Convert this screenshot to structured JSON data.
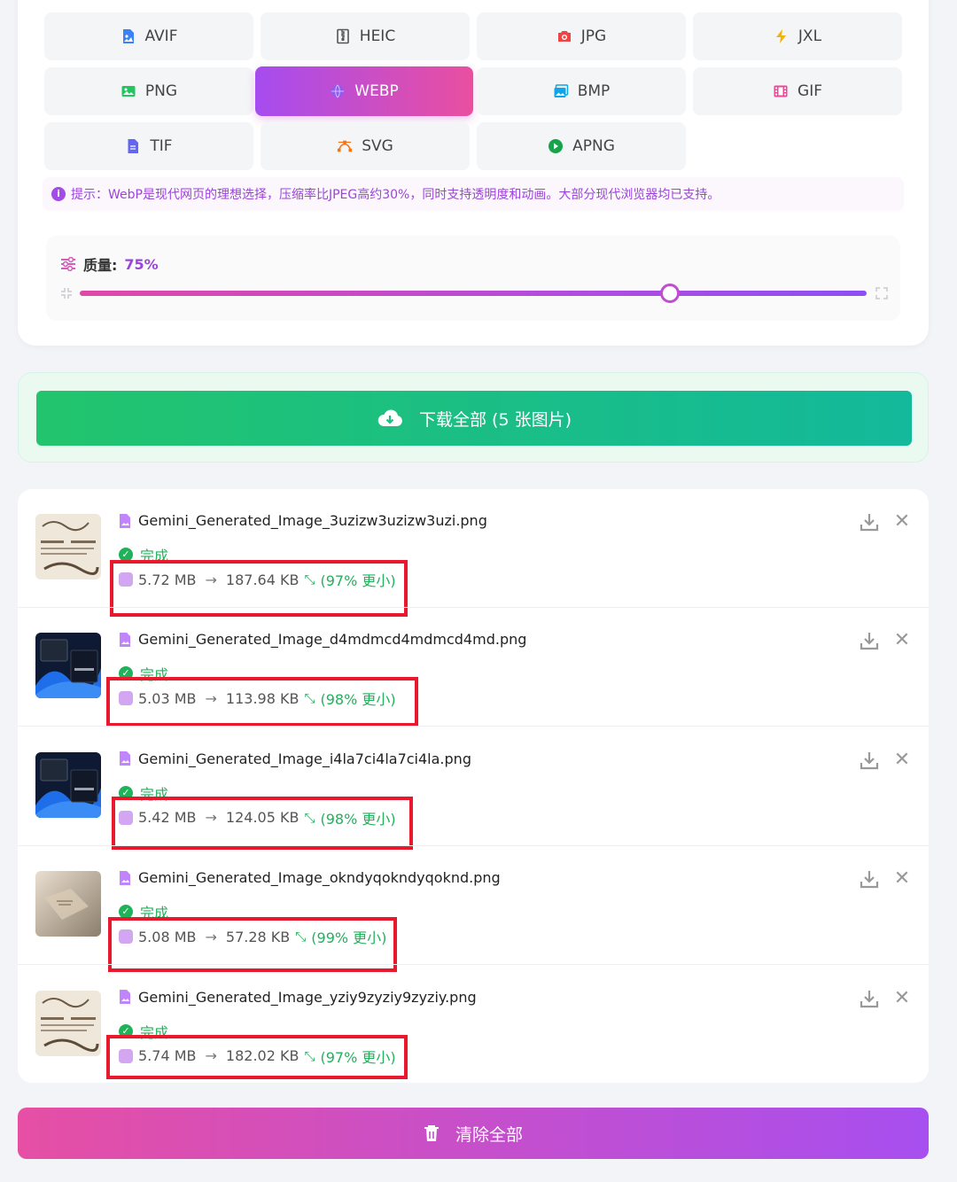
{
  "formats": [
    {
      "label": "AVIF",
      "icon": "file-image-icon",
      "color": "#3b82f6"
    },
    {
      "label": "HEIC",
      "icon": "file-zip-icon",
      "color": "#555555"
    },
    {
      "label": "JPG",
      "icon": "camera-icon",
      "color": "#ef4444"
    },
    {
      "label": "JXL",
      "icon": "bolt-icon",
      "color": "#f5b301"
    },
    {
      "label": "PNG",
      "icon": "image-icon",
      "color": "#22c55e"
    },
    {
      "label": "WEBP",
      "icon": "globe-icon",
      "color": "#8b5cf6",
      "active": true
    },
    {
      "label": "BMP",
      "icon": "images-icon",
      "color": "#0ea5e9"
    },
    {
      "label": "GIF",
      "icon": "film-icon",
      "color": "#ec4899"
    },
    {
      "label": "TIF",
      "icon": "file-icon",
      "color": "#6366f1"
    },
    {
      "label": "SVG",
      "icon": "vector-icon",
      "color": "#f97316"
    },
    {
      "label": "APNG",
      "icon": "play-circle-icon",
      "color": "#16a34a"
    }
  ],
  "tip": {
    "icon": "info-icon",
    "text": "提示：WebP是现代网页的理想选择，压缩率比JPEG高约30%，同时支持透明度和动画。大部分现代浏览器均已支持。"
  },
  "quality": {
    "label": "质量:",
    "value_text": "75%",
    "value": 0.75
  },
  "download_all": {
    "label": "下载全部 (5 张图片)",
    "icon": "cloud-download-icon"
  },
  "files": [
    {
      "name": "Gemini_Generated_Image_3uzizw3uzizw3uzi.png",
      "status": "完成",
      "original": "5.72 MB",
      "arrow": "→",
      "compressed": "187.64 KB",
      "saving": "(97% 更小)",
      "thumb": "sketch"
    },
    {
      "name": "Gemini_Generated_Image_d4mdmcd4mdmcd4md.png",
      "status": "完成",
      "original": "5.03 MB",
      "arrow": "→",
      "compressed": "113.98 KB",
      "saving": "(98% 更小)",
      "thumb": "desktop"
    },
    {
      "name": "Gemini_Generated_Image_i4la7ci4la7ci4la.png",
      "status": "完成",
      "original": "5.42 MB",
      "arrow": "→",
      "compressed": "124.05 KB",
      "saving": "(98% 更小)",
      "thumb": "desktop"
    },
    {
      "name": "Gemini_Generated_Image_okndyqokndyqoknd.png",
      "status": "完成",
      "original": "5.08 MB",
      "arrow": "→",
      "compressed": "57.28 KB",
      "saving": "(99% 更小)",
      "thumb": "paper"
    },
    {
      "name": "Gemini_Generated_Image_yziy9zyziy9zyziy.png",
      "status": "完成",
      "original": "5.74 MB",
      "arrow": "→",
      "compressed": "182.02 KB",
      "saving": "(97% 更小)",
      "thumb": "sketch"
    }
  ],
  "clear_all": {
    "label": "清除全部",
    "icon": "trash-icon"
  },
  "colors": {
    "accent_purple": "#9b45d8",
    "accent_pink": "#e64fa4",
    "success": "#20b25b",
    "highlight_red": "#e8192c"
  }
}
